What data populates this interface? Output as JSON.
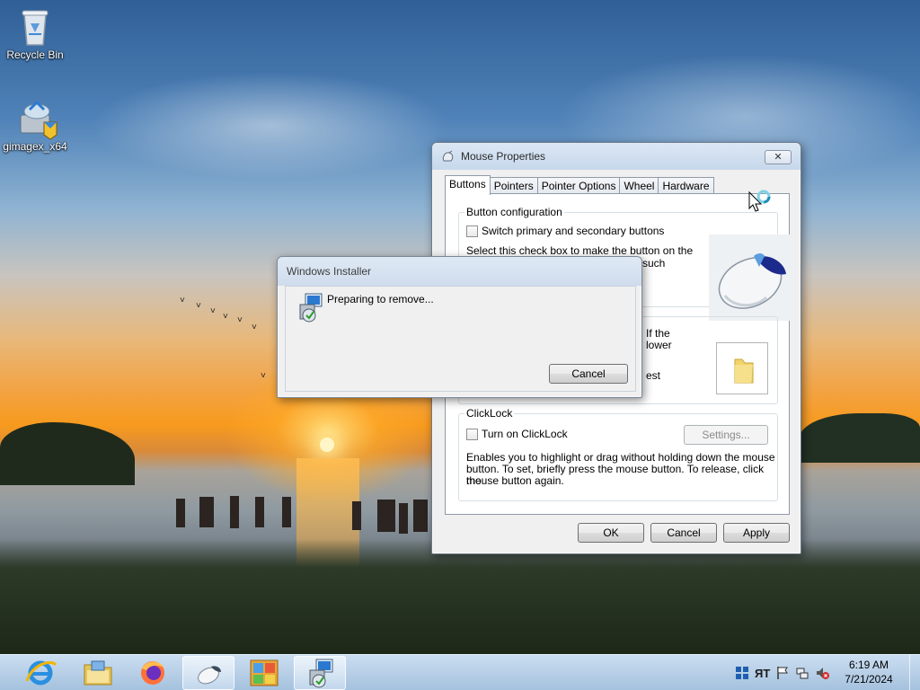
{
  "desktop": {
    "icons": [
      {
        "label": "Recycle Bin",
        "icon": "recycle-bin-icon"
      },
      {
        "label": "gimagex_x64",
        "icon": "installer-package-icon"
      }
    ]
  },
  "mouse_properties": {
    "title": "Mouse Properties",
    "close_label": "✕",
    "tabs": [
      "Buttons",
      "Pointers",
      "Pointer Options",
      "Wheel",
      "Hardware"
    ],
    "active_tab": "Buttons",
    "button_config": {
      "group_label": "Button configuration",
      "checkbox_label": "Switch primary and secondary buttons",
      "description_line1": "Select this check box to make the button on the",
      "description_line2": "such",
      "checked": false
    },
    "double_click": {
      "fragment1": "If the",
      "fragment2": "lower",
      "fragment3": "est"
    },
    "clicklock": {
      "group_label": "ClickLock",
      "checkbox_label": "Turn on ClickLock",
      "settings_label": "Settings...",
      "description_line1": "Enables you to highlight or drag without holding down the mouse",
      "description_line2": "button. To set, briefly press the mouse button. To release, click the",
      "description_line3": "mouse button again.",
      "checked": false
    },
    "buttons": {
      "ok": "OK",
      "cancel": "Cancel",
      "apply": "Apply"
    }
  },
  "installer": {
    "title": "Windows Installer",
    "message": "Preparing to remove...",
    "cancel_label": "Cancel"
  },
  "taskbar": {
    "apps": [
      "internet-explorer-icon",
      "file-explorer-icon",
      "firefox-icon",
      "mouse-properties-icon",
      "control-panel-icon",
      "windows-installer-icon"
    ],
    "active_index": 3,
    "tray_icons": [
      "action-center-icon",
      "input-method-icon",
      "flag-icon",
      "network-icon",
      "volume-muted-icon"
    ],
    "ime_label": "ЯТ",
    "time": "6:19 AM",
    "date": "7/21/2024"
  }
}
